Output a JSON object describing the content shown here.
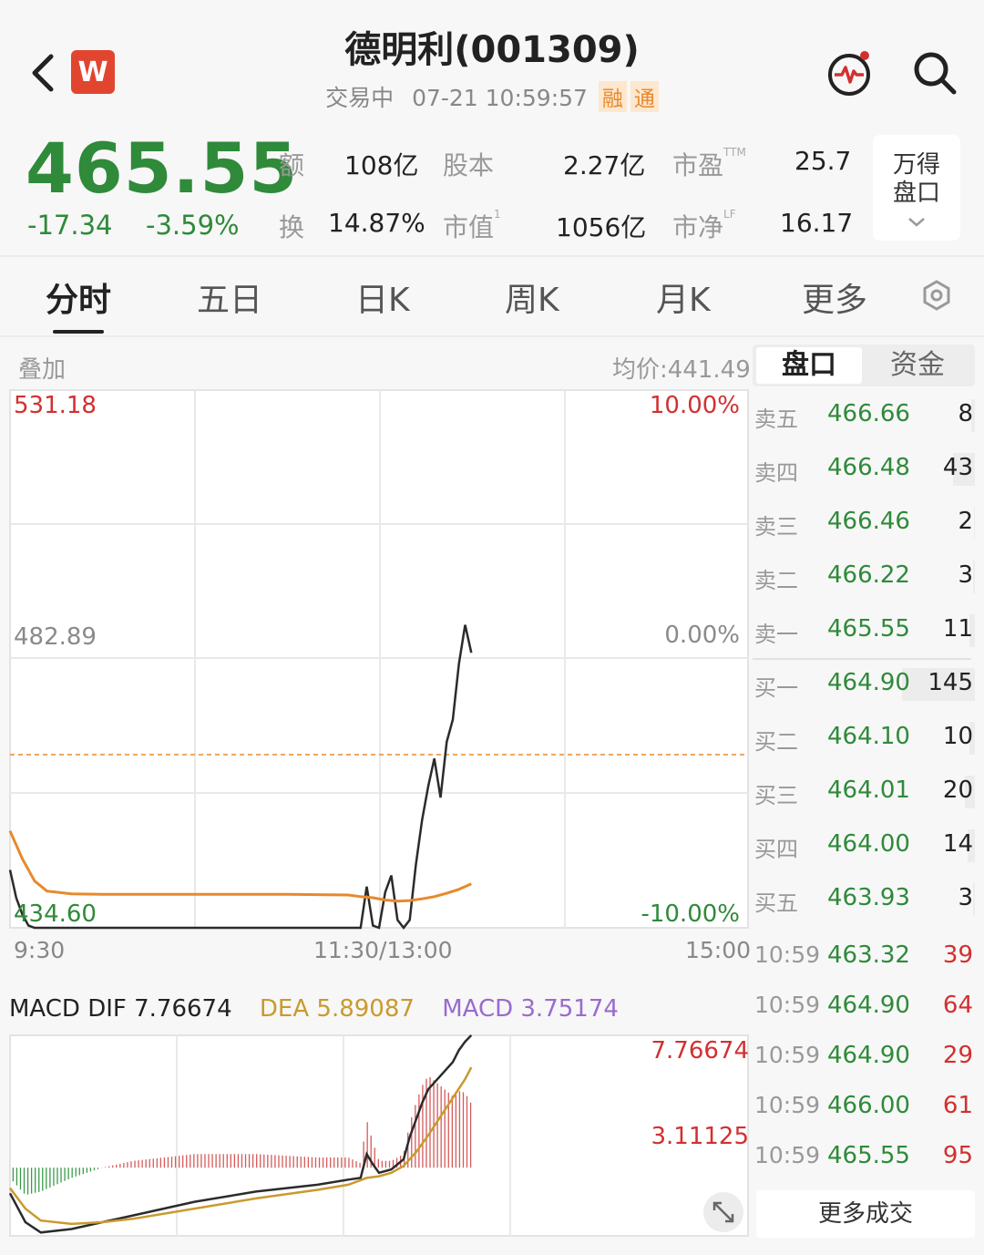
{
  "header": {
    "title": "德明利(001309)",
    "status": "交易中",
    "datetime": "07-21 10:59:57",
    "tags": [
      "融",
      "通"
    ],
    "logo_letter": "W"
  },
  "quote": {
    "price": "465.55",
    "change": "-17.34",
    "change_pct": "-3.59%",
    "stats": [
      {
        "label": "额",
        "value": "108亿"
      },
      {
        "label": "股本",
        "value": "2.27亿"
      },
      {
        "label": "市盈",
        "sup": "TTM",
        "value": "25.7"
      },
      {
        "label": "换",
        "value": "14.87%"
      },
      {
        "label": "市值",
        "sup": "1",
        "value": "1056亿"
      },
      {
        "label": "市净",
        "sup": "LF",
        "value": "16.17"
      }
    ],
    "wind_button": [
      "万得",
      "盘口"
    ]
  },
  "tabs": [
    "分时",
    "五日",
    "日K",
    "周K",
    "月K",
    "更多"
  ],
  "chart": {
    "overlay_label": "叠加",
    "avg_price": "均价:441.49",
    "y_left": [
      "531.18",
      "482.89",
      "434.60"
    ],
    "y_right": [
      "10.00%",
      "0.00%",
      "-10.00%"
    ],
    "x_labels": [
      "9:30",
      "11:30/13:00",
      "15:00"
    ],
    "macd": {
      "dif": "MACD DIF 7.76674",
      "dea": "DEA 5.89087",
      "macd": "MACD 3.75174",
      "y_top": "7.76674",
      "y_mid": "3.11125"
    }
  },
  "chart_data": [
    {
      "type": "line",
      "title": "",
      "ylim": [
        434.6,
        531.18
      ],
      "x_range": [
        0,
        240
      ],
      "series": [
        {
          "x": [
            0,
            2,
            4,
            6,
            8,
            10,
            12,
            14,
            16,
            18,
            20,
            24,
            28,
            35,
            45,
            60,
            75,
            90,
            105,
            110,
            114,
            116,
            118,
            120,
            122,
            124,
            126,
            128,
            130,
            132,
            134,
            136,
            138,
            140,
            142,
            144,
            146,
            148,
            150
          ],
          "values": [
            445,
            440,
            437,
            435,
            434.6,
            434.6,
            434.6,
            434.6,
            434.6,
            434.6,
            434.6,
            434.6,
            434.6,
            434.6,
            434.6,
            434.6,
            434.6,
            434.6,
            434.6,
            434.6,
            434.6,
            442,
            435,
            434.6,
            441,
            444,
            436,
            434.6,
            436,
            446,
            454,
            460,
            465,
            458,
            468,
            472,
            482,
            489,
            484
          ]
        },
        {
          "x": [
            0,
            4,
            8,
            12,
            20,
            30,
            60,
            90,
            110,
            114,
            118,
            122,
            126,
            130,
            134,
            138,
            142,
            146,
            150
          ],
          "values": [
            452,
            447,
            443,
            441.2,
            440.7,
            440.6,
            440.6,
            440.6,
            440.5,
            440.2,
            440,
            439.6,
            439.4,
            439.5,
            439.8,
            440.2,
            440.8,
            441.5,
            442.5
          ]
        }
      ]
    },
    {
      "type": "line",
      "title": "",
      "ylim": [
        -4,
        7.76674
      ],
      "series": [
        {
          "x": [
            0,
            5,
            10,
            20,
            30,
            40,
            60,
            80,
            100,
            110,
            114,
            116,
            118,
            120,
            124,
            128,
            130,
            134,
            136,
            140,
            144,
            146,
            148,
            150
          ],
          "values": [
            -1.5,
            -3.2,
            -3.8,
            -3.6,
            -3.2,
            -2.8,
            -2.0,
            -1.4,
            -1.0,
            -0.7,
            -0.6,
            0.8,
            0.2,
            -0.3,
            -0.1,
            0.5,
            1.8,
            3.8,
            4.6,
            5.4,
            6.2,
            6.9,
            7.4,
            7.77
          ]
        },
        {
          "x": [
            0,
            5,
            10,
            20,
            30,
            40,
            60,
            80,
            100,
            110,
            116,
            120,
            124,
            128,
            132,
            136,
            140,
            144,
            148,
            150
          ],
          "values": [
            -1.2,
            -2.4,
            -3.1,
            -3.3,
            -3.2,
            -3.0,
            -2.4,
            -1.8,
            -1.3,
            -1.0,
            -0.6,
            -0.5,
            -0.3,
            0.1,
            0.9,
            1.9,
            3.0,
            4.1,
            5.2,
            5.89
          ]
        }
      ]
    }
  ],
  "orderbook": {
    "tab_active": "盘口",
    "tab_other": "资金",
    "asks": [
      {
        "label": "卖五",
        "price": "466.66",
        "vol": "8"
      },
      {
        "label": "卖四",
        "price": "466.48",
        "vol": "43"
      },
      {
        "label": "卖三",
        "price": "466.46",
        "vol": "2"
      },
      {
        "label": "卖二",
        "price": "466.22",
        "vol": "3"
      },
      {
        "label": "卖一",
        "price": "465.55",
        "vol": "11"
      }
    ],
    "bids": [
      {
        "label": "买一",
        "price": "464.90",
        "vol": "145"
      },
      {
        "label": "买二",
        "price": "464.10",
        "vol": "10"
      },
      {
        "label": "买三",
        "price": "464.01",
        "vol": "20"
      },
      {
        "label": "买四",
        "price": "464.00",
        "vol": "14"
      },
      {
        "label": "买五",
        "price": "463.93",
        "vol": "3"
      }
    ],
    "trades": [
      {
        "time": "10:59",
        "price": "463.32",
        "vol": "39"
      },
      {
        "time": "10:59",
        "price": "464.90",
        "vol": "64"
      },
      {
        "time": "10:59",
        "price": "464.90",
        "vol": "29"
      },
      {
        "time": "10:59",
        "price": "466.00",
        "vol": "61"
      },
      {
        "time": "10:59",
        "price": "465.55",
        "vol": "95"
      }
    ],
    "more_trades": "更多成交"
  }
}
